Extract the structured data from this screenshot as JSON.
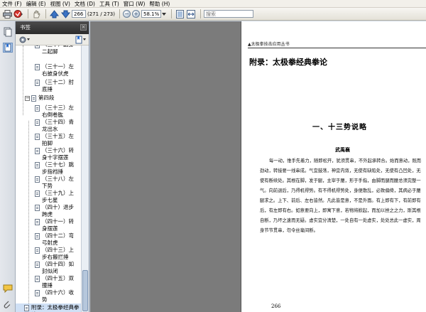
{
  "menu": [
    "文件 (F)",
    "编辑 (E)",
    "视图 (V)",
    "文档 (D)",
    "工具 (T)",
    "窗口 (W)",
    "帮助 (H)"
  ],
  "toolbar": {
    "page_current": "266",
    "page_total": "(271 / 273)",
    "zoom": "58.1%",
    "search_placeholder": "搜索"
  },
  "bookmarks_panel": {
    "title": "书签",
    "items": [
      {
        "label": "（三十）翻身二起脚"
      },
      {
        "label": "（三十一）左右披身伏虎"
      },
      {
        "label": "（三十二）肘底捶"
      },
      {
        "label": "第四段",
        "group": true
      },
      {
        "label": "（三十三）左右倒卷肱"
      },
      {
        "label": "（三十四）青龙出水"
      },
      {
        "label": "（三十五）左拍脚"
      },
      {
        "label": "（三十六）转身十字摆莲"
      },
      {
        "label": "（三十七）跳步指裆捶"
      },
      {
        "label": "（三十八）左下势"
      },
      {
        "label": "（三十九）上步七星"
      },
      {
        "label": "（四十）退步跨虎"
      },
      {
        "label": "（四十一）转身摆莲"
      },
      {
        "label": "（四十二）弯弓射虎"
      },
      {
        "label": "（四十三）上步右搬拦捶"
      },
      {
        "label": "（四十四）如封似闭"
      },
      {
        "label": "（四十五）双撞捶"
      },
      {
        "label": "（四十六）收势"
      },
      {
        "label": "附录：太极拳经典拳论",
        "selected": true
      }
    ]
  },
  "page": {
    "running_head": "▲太极拳技击应用丛书",
    "appendix_title": "附录：太极拳经典拳论",
    "section_title": "一、十三势说略",
    "author": "武禹襄",
    "body": "每一动，惟手先着力，随即松开，犹须贯串，不外起承转合。始而意动，既而劲动，转接要一线串成。气宜鼓荡，神宜内敛，无使有缺陷处，无使有凸凹处，无使有断续处。其根在脚，发于腿，主宰于腰，形于手指，由脚而腿而腰总须完整一气。向前退后，乃得机得势。有不得机得势处，身便散乱，必致偏倚，其病必于腰腿求之。上下、前后、左右皆然。凡此皆是意，不是外面。有上即有下，有前即有后，有左即有右。如意要向上，即寓下意，若物将掀起，而加以挫之之力，斯其根自断，乃坏之速而无疑。虚实宜分清楚，一处自有一处虚实，处处总此一虚实，周身节节贯串，勿令丝毫间断。",
    "page_number": "266"
  }
}
